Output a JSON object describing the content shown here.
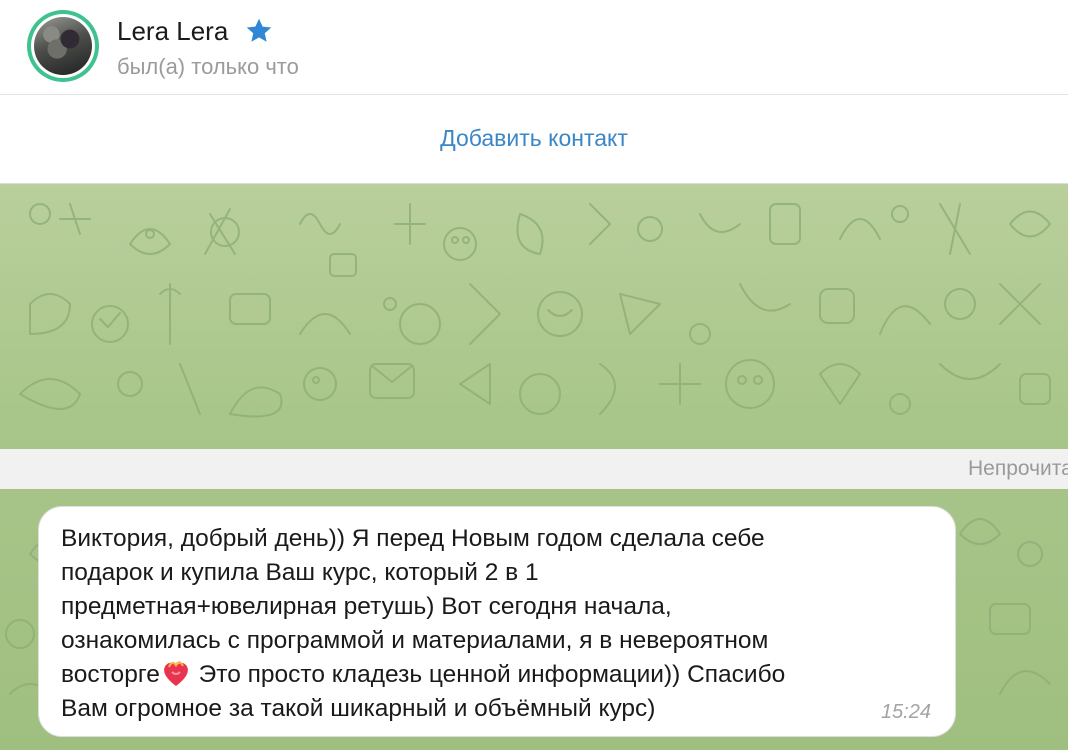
{
  "header": {
    "contact_name": "Lera Lera",
    "status": "был(а) только что",
    "badge_icon": "star-icon",
    "accent_color": "#2f87d6"
  },
  "actions": {
    "add_contact_label": "Добавить контакт"
  },
  "chat": {
    "unread_divider": "Непрочитанные сообщения",
    "message": {
      "text_part1": "Виктория, добрый день)) Я перед Новым годом сделала себе\nподарок и купила Ваш курс, который 2 в 1\nпредметная+ювелирная ретушь) Вот сегодня начала,\nознакомилась с программой и материалами, я в невероятном\nвосторге",
      "emoji": "heart-on-fire-icon",
      "text_part2": "  Это просто кладезь ценной информации)) Спасибо\nВам огромное за такой шикарный и объёмный курс)",
      "time": "15:24"
    }
  }
}
